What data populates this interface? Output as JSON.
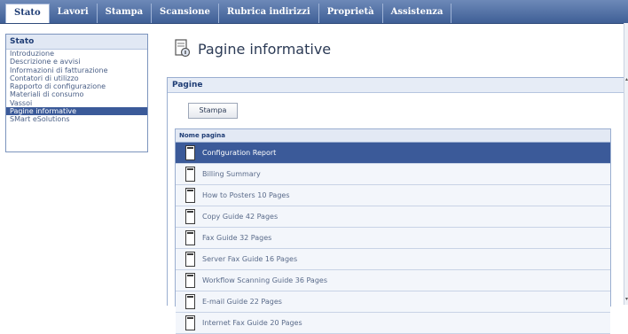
{
  "tabs": [
    {
      "label": "Stato"
    },
    {
      "label": "Lavori"
    },
    {
      "label": "Stampa"
    },
    {
      "label": "Scansione"
    },
    {
      "label": "Rubrica indirizzi"
    },
    {
      "label": "Proprietà"
    },
    {
      "label": "Assistenza"
    }
  ],
  "nav": {
    "title": "Stato",
    "items": [
      {
        "label": "Introduzione"
      },
      {
        "label": "Descrizione e avvisi"
      },
      {
        "label": "Informazioni di fatturazione"
      },
      {
        "label": "Contatori di utilizzo"
      },
      {
        "label": "Rapporto di configurazione"
      },
      {
        "label": "Materiali di consumo"
      },
      {
        "label": "Vassoi"
      },
      {
        "label": "Pagine informative"
      },
      {
        "label": "SMart eSolutions"
      }
    ]
  },
  "page": {
    "title": "Pagine informative"
  },
  "panel": {
    "title": "Pagine",
    "print_button": "Stampa",
    "column_header": "Nome pagina",
    "rows": [
      {
        "name": "Configuration Report"
      },
      {
        "name": "Billing Summary"
      },
      {
        "name": "How to Posters 10 Pages"
      },
      {
        "name": "Copy Guide 42 Pages"
      },
      {
        "name": "Fax Guide 32 Pages"
      },
      {
        "name": "Server Fax Guide 16 Pages"
      },
      {
        "name": "Workflow Scanning Guide 36 Pages"
      },
      {
        "name": "E-mail Guide 22 Pages"
      },
      {
        "name": "Internet Fax Guide 20 Pages"
      }
    ]
  },
  "colors": {
    "accent": "#3b5a99",
    "tabbar": "#4a6aa3"
  }
}
